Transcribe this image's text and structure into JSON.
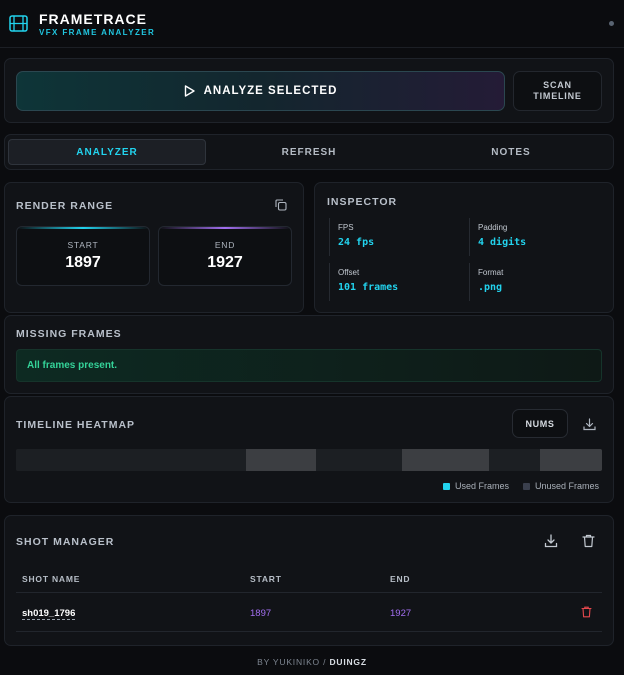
{
  "header": {
    "title": "FRAMETRACE",
    "subtitle": "VFX FRAME ANALYZER"
  },
  "actions": {
    "analyze_label": "ANALYZE SELECTED",
    "scan_label": "SCAN TIMELINE"
  },
  "tabs": [
    {
      "label": "ANALYZER",
      "active": true
    },
    {
      "label": "REFRESH",
      "active": false
    },
    {
      "label": "NOTES",
      "active": false
    }
  ],
  "render_range": {
    "title": "RENDER RANGE",
    "start_label": "START",
    "start_value": "1897",
    "end_label": "END",
    "end_value": "1927"
  },
  "inspector": {
    "title": "INSPECTOR",
    "fields": [
      {
        "key": "FPS",
        "value": "24 fps"
      },
      {
        "key": "Padding",
        "value": "4 digits"
      },
      {
        "key": "Offset",
        "value": "101 frames"
      },
      {
        "key": "Format",
        "value": ".png"
      }
    ]
  },
  "missing_frames": {
    "title": "MISSING FRAMES",
    "message": "All frames present."
  },
  "heatmap": {
    "title": "TIMELINE HEATMAP",
    "nums_label": "NUMS",
    "legend_used": "Used Frames",
    "legend_unused": "Unused Frames"
  },
  "shot_manager": {
    "title": "SHOT MANAGER",
    "columns": [
      "SHOT NAME",
      "START",
      "END"
    ],
    "rows": [
      {
        "name": "sh019_1796",
        "start": "1897",
        "end": "1927"
      }
    ]
  },
  "footer": {
    "prefix": "BY YUKINIKO /",
    "brand": "DUINGZ"
  },
  "colors": {
    "accent_cyan": "#22d3ee",
    "accent_purple": "#a26ff0",
    "success_green": "#34d399",
    "danger_red": "#e5484d"
  }
}
